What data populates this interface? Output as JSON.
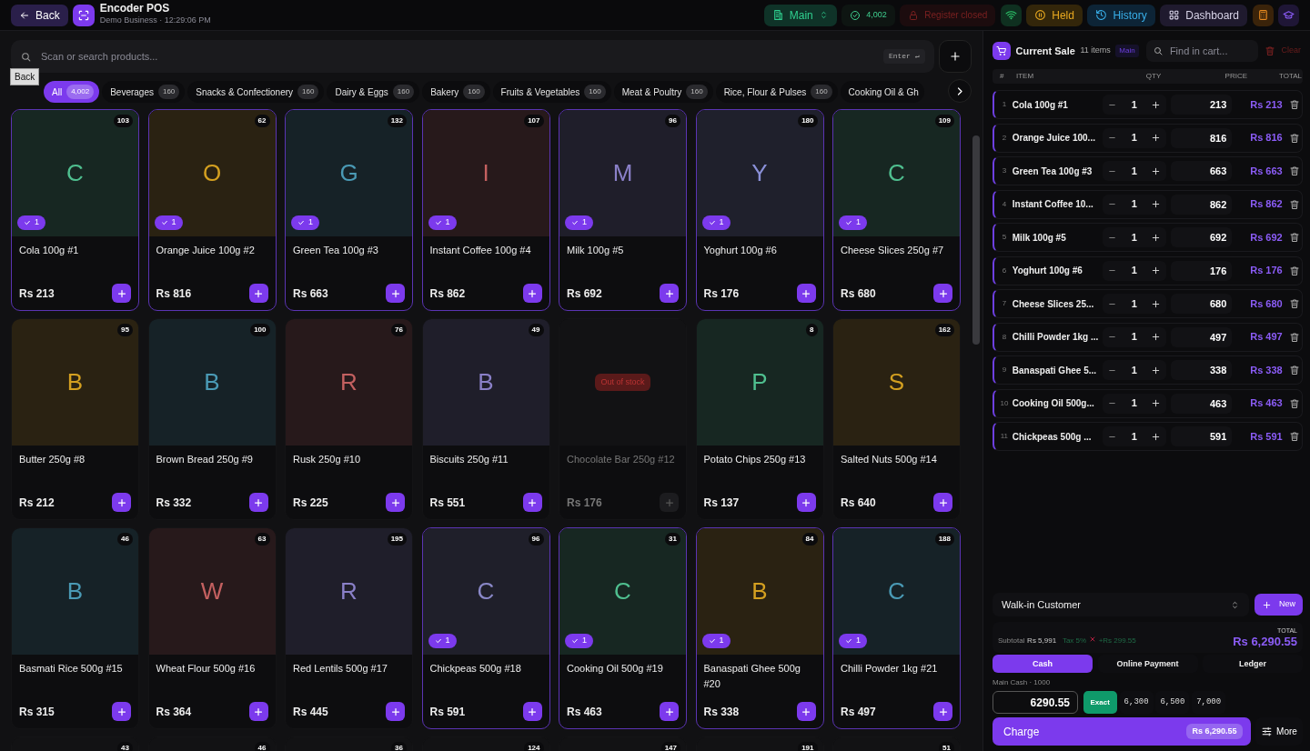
{
  "header": {
    "back_label": "Back",
    "app_title": "Encoder POS",
    "subtitle": "Demo Business · 12:29:06 PM",
    "branch": "Main",
    "product_count": "4,002",
    "register_status": "Register closed",
    "held_label": "Held",
    "history_label": "History",
    "dashboard_label": "Dashboard"
  },
  "tooltip": "Back",
  "search": {
    "placeholder": "Scan or search products...",
    "shortcut": "Enter ↵"
  },
  "categories": [
    {
      "label": "All",
      "count": "4,002",
      "selected": true
    },
    {
      "label": "Beverages",
      "count": "160",
      "selected": false
    },
    {
      "label": "Snacks & Confectionery",
      "count": "160",
      "selected": false
    },
    {
      "label": "Dairy & Eggs",
      "count": "160",
      "selected": false
    },
    {
      "label": "Bakery",
      "count": "160",
      "selected": false
    },
    {
      "label": "Fruits & Vegetables",
      "count": "160",
      "selected": false
    },
    {
      "label": "Meat & Poultry",
      "count": "160",
      "selected": false
    },
    {
      "label": "Rice, Flour & Pulses",
      "count": "160",
      "selected": false
    },
    {
      "label": "Cooking Oil & Gh",
      "selected": false
    }
  ],
  "products": [
    {
      "initial": "C",
      "name": "Cola 100g #1",
      "price": "Rs 213",
      "stock": "103",
      "color": "#4fbf8f",
      "in_cart": true,
      "cart_qty": "1"
    },
    {
      "initial": "O",
      "name": "Orange Juice 100g #2",
      "price": "Rs 816",
      "stock": "62",
      "color": "#d4a020",
      "in_cart": true,
      "cart_qty": "1"
    },
    {
      "initial": "G",
      "name": "Green Tea 100g #3",
      "price": "Rs 663",
      "stock": "132",
      "color": "#4a9ab5",
      "in_cart": true,
      "cart_qty": "1"
    },
    {
      "initial": "I",
      "name": "Instant Coffee 100g #4",
      "price": "Rs 862",
      "stock": "107",
      "color": "#c46060",
      "in_cart": true,
      "cart_qty": "1"
    },
    {
      "initial": "M",
      "name": "Milk 100g #5",
      "price": "Rs 692",
      "stock": "96",
      "color": "#8a80c8",
      "in_cart": true,
      "cart_qty": "1"
    },
    {
      "initial": "Y",
      "name": "Yoghurt 100g #6",
      "price": "Rs 176",
      "stock": "180",
      "color": "#8a90d8",
      "in_cart": true,
      "cart_qty": "1"
    },
    {
      "initial": "C",
      "name": "Cheese Slices 250g #7",
      "price": "Rs 680",
      "stock": "109",
      "color": "#4fbf8f",
      "in_cart": true,
      "cart_qty": "1"
    },
    {
      "initial": "B",
      "name": "Butter 250g #8",
      "price": "Rs 212",
      "stock": "95",
      "color": "#d4a020",
      "in_cart": false
    },
    {
      "initial": "B",
      "name": "Brown Bread 250g #9",
      "price": "Rs 332",
      "stock": "100",
      "color": "#4a9ab5",
      "in_cart": false
    },
    {
      "initial": "R",
      "name": "Rusk 250g #10",
      "price": "Rs 225",
      "stock": "76",
      "color": "#c46060",
      "in_cart": false
    },
    {
      "initial": "B",
      "name": "Biscuits 250g #11",
      "price": "Rs 551",
      "stock": "49",
      "color": "#8a80c8",
      "in_cart": false
    },
    {
      "name": "Chocolate Bar 250g #12",
      "price": "Rs 176",
      "in_cart": false,
      "disabled": true,
      "badge": "Out of stock"
    },
    {
      "initial": "P",
      "name": "Potato Chips 250g #13",
      "price": "Rs 137",
      "stock": "8",
      "color": "#4fbf8f",
      "in_cart": false
    },
    {
      "initial": "S",
      "name": "Salted Nuts 500g #14",
      "price": "Rs 640",
      "stock": "162",
      "color": "#d4a020",
      "in_cart": false
    },
    {
      "initial": "B",
      "name": "Basmati Rice 500g #15",
      "price": "Rs 315",
      "stock": "46",
      "color": "#4a9ab5",
      "in_cart": false
    },
    {
      "initial": "W",
      "name": "Wheat Flour 500g #16",
      "price": "Rs 364",
      "stock": "63",
      "color": "#c46060",
      "in_cart": false
    },
    {
      "initial": "R",
      "name": "Red Lentils 500g #17",
      "price": "Rs 445",
      "stock": "195",
      "color": "#8a80c8",
      "in_cart": false
    },
    {
      "initial": "C",
      "name": "Chickpeas 500g #18",
      "price": "Rs 591",
      "stock": "96",
      "color": "#8a88c8",
      "in_cart": true,
      "cart_qty": "1"
    },
    {
      "initial": "C",
      "name": "Cooking Oil 500g #19",
      "price": "Rs 463",
      "stock": "31",
      "color": "#4fbf8f",
      "in_cart": true,
      "cart_qty": "1"
    },
    {
      "initial": "B",
      "name": "Banaspati Ghee 500g #20",
      "price": "Rs 338",
      "stock": "84",
      "color": "#d4a020",
      "in_cart": true,
      "cart_qty": "1"
    },
    {
      "initial": "C",
      "name": "Chilli Powder 1kg #21",
      "price": "Rs 497",
      "stock": "188",
      "color": "#4a9ab5",
      "in_cart": true,
      "cart_qty": "1"
    },
    {
      "stock": "43",
      "in_cart": false
    },
    {
      "stock": "46",
      "in_cart": false
    },
    {
      "stock": "36",
      "in_cart": false
    },
    {
      "stock": "124",
      "in_cart": false
    },
    {
      "stock": "147",
      "in_cart": false
    },
    {
      "stock": "191",
      "in_cart": false
    },
    {
      "stock": "51",
      "in_cart": false
    }
  ],
  "cart": {
    "title": "Current Sale",
    "count": "11 items",
    "branch": "Main",
    "search_placeholder": "Find in cart...",
    "clear_label": "Clear",
    "columns": [
      "#",
      "ITEM",
      "QTY",
      "PRICE",
      "TOTAL"
    ],
    "rows": [
      {
        "index": "1",
        "name": "Cola 100g #1",
        "qty": "1",
        "price": "213",
        "total": "Rs 213"
      },
      {
        "index": "2",
        "name": "Orange Juice 100...",
        "qty": "1",
        "price": "816",
        "total": "Rs 816"
      },
      {
        "index": "3",
        "name": "Green Tea 100g #3",
        "qty": "1",
        "price": "663",
        "total": "Rs 663"
      },
      {
        "index": "4",
        "name": "Instant Coffee 10...",
        "qty": "1",
        "price": "862",
        "total": "Rs 862"
      },
      {
        "index": "5",
        "name": "Milk 100g #5",
        "qty": "1",
        "price": "692",
        "total": "Rs 692"
      },
      {
        "index": "6",
        "name": "Yoghurt 100g #6",
        "qty": "1",
        "price": "176",
        "total": "Rs 176"
      },
      {
        "index": "7",
        "name": "Cheese Slices 25...",
        "qty": "1",
        "price": "680",
        "total": "Rs 680"
      },
      {
        "index": "8",
        "name": "Chilli Powder 1kg ...",
        "qty": "1",
        "price": "497",
        "total": "Rs 497"
      },
      {
        "index": "9",
        "name": "Banaspati Ghee 5...",
        "qty": "1",
        "price": "338",
        "total": "Rs 338"
      },
      {
        "index": "10",
        "name": "Cooking Oil 500g...",
        "qty": "1",
        "price": "463",
        "total": "Rs 463"
      },
      {
        "index": "11",
        "name": "Chickpeas 500g ...",
        "qty": "1",
        "price": "591",
        "total": "Rs 591"
      }
    ]
  },
  "customer": {
    "value": "Walk-in Customer",
    "new_label": "New"
  },
  "summary": {
    "subtotal_label": "Subtotal",
    "subtotal": "Rs 5,991",
    "tax": "Tax 5%",
    "tax_amount": "+Rs 299.55",
    "total_label": "TOTAL",
    "total": "Rs 6,290.55"
  },
  "payment_methods": [
    {
      "label": "Cash",
      "selected": true
    },
    {
      "label": "Online Payment",
      "selected": false
    },
    {
      "label": "Ledger",
      "selected": false
    }
  ],
  "cash_account": "Main Cash · 1000",
  "tendered": "6290.55",
  "exact_label": "Exact",
  "quick_amounts": [
    "6,300",
    "6,500",
    "7,000"
  ],
  "charge": {
    "label": "Charge",
    "amount": "Rs 6,290.55"
  },
  "more_label": "More"
}
